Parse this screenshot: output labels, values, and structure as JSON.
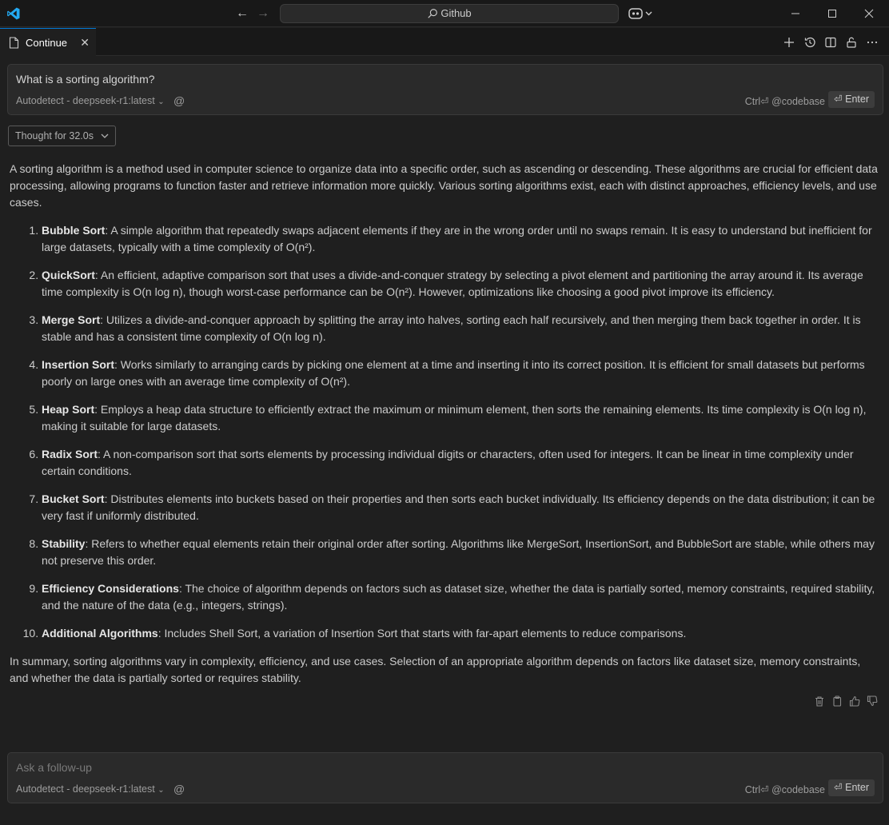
{
  "titlebar": {
    "search_text": "Github",
    "icons": [
      "vscode-logo-icon",
      "arrow-left-icon",
      "arrow-right-icon",
      "search-icon",
      "copilot-icon",
      "chevron-down-icon",
      "minimize-icon",
      "maximize-icon",
      "close-icon"
    ]
  },
  "tab": {
    "label": "Continue",
    "close": "✕",
    "actions": [
      "plus-icon",
      "history-icon",
      "split-editor-icon",
      "lock-icon",
      "more-icon"
    ]
  },
  "top_input": {
    "text": "What is a sorting algorithm?",
    "model": "Autodetect - deepseek-r1:latest",
    "hint": "Ctrl⏎ @codebase",
    "enter_label": "⏎ Enter"
  },
  "thought": {
    "label": "Thought for 32.0s"
  },
  "answer": {
    "intro": "A sorting algorithm is a method used in computer science to organize data into a specific order, such as ascending or descending. These algorithms are crucial for efficient data processing, allowing programs to function faster and retrieve information more quickly. Various sorting algorithms exist, each with distinct approaches, efficiency levels, and use cases.",
    "items": [
      {
        "title": "Bubble Sort",
        "text": ": A simple algorithm that repeatedly swaps adjacent elements if they are in the wrong order until no swaps remain. It is easy to understand but inefficient for large datasets, typically with a time complexity of O(n²)."
      },
      {
        "title": "QuickSort",
        "text": ": An efficient, adaptive comparison sort that uses a divide-and-conquer strategy by selecting a pivot element and partitioning the array around it. Its average time complexity is O(n log n), though worst-case performance can be O(n²). However, optimizations like choosing a good pivot improve its efficiency."
      },
      {
        "title": "Merge Sort",
        "text": ": Utilizes a divide-and-conquer approach by splitting the array into halves, sorting each half recursively, and then merging them back together in order. It is stable and has a consistent time complexity of O(n log n)."
      },
      {
        "title": "Insertion Sort",
        "text": ": Works similarly to arranging cards by picking one element at a time and inserting it into its correct position. It is efficient for small datasets but performs poorly on large ones with an average time complexity of O(n²)."
      },
      {
        "title": "Heap Sort",
        "text": ": Employs a heap data structure to efficiently extract the maximum or minimum element, then sorts the remaining elements. Its time complexity is O(n log n), making it suitable for large datasets."
      },
      {
        "title": "Radix Sort",
        "text": ": A non-comparison sort that sorts elements by processing individual digits or characters, often used for integers. It can be linear in time complexity under certain conditions."
      },
      {
        "title": "Bucket Sort",
        "text": ": Distributes elements into buckets based on their properties and then sorts each bucket individually. Its efficiency depends on the data distribution; it can be very fast if uniformly distributed."
      },
      {
        "title": "Stability",
        "text": ": Refers to whether equal elements retain their original order after sorting. Algorithms like MergeSort, InsertionSort, and BubbleSort are stable, while others may not preserve this order."
      },
      {
        "title": "Efficiency Considerations",
        "text": ": The choice of algorithm depends on factors such as dataset size, whether the data is partially sorted, memory constraints, required stability, and the nature of the data (e.g., integers, strings)."
      },
      {
        "title": "Additional Algorithms",
        "text": ": Includes Shell Sort, a variation of Insertion Sort that starts with far-apart elements to reduce comparisons."
      }
    ],
    "summary": "In summary, sorting algorithms vary in complexity, efficiency, and use cases. Selection of an appropriate algorithm depends on factors like dataset size, memory constraints, and whether the data is partially sorted or requires stability."
  },
  "message_actions": [
    "trash-icon",
    "copy-icon",
    "thumbs-up-icon",
    "thumbs-down-icon"
  ],
  "bottom_input": {
    "placeholder": "Ask a follow-up",
    "model": "Autodetect - deepseek-r1:latest",
    "hint": "Ctrl⏎ @codebase",
    "enter_label": "⏎ Enter"
  },
  "colors": {
    "background": "#1f1f1f",
    "titlebar": "#181818",
    "input_bg": "#2a2a2a",
    "accent": "#0078d4",
    "vscode_blue": "#23a9f2"
  }
}
